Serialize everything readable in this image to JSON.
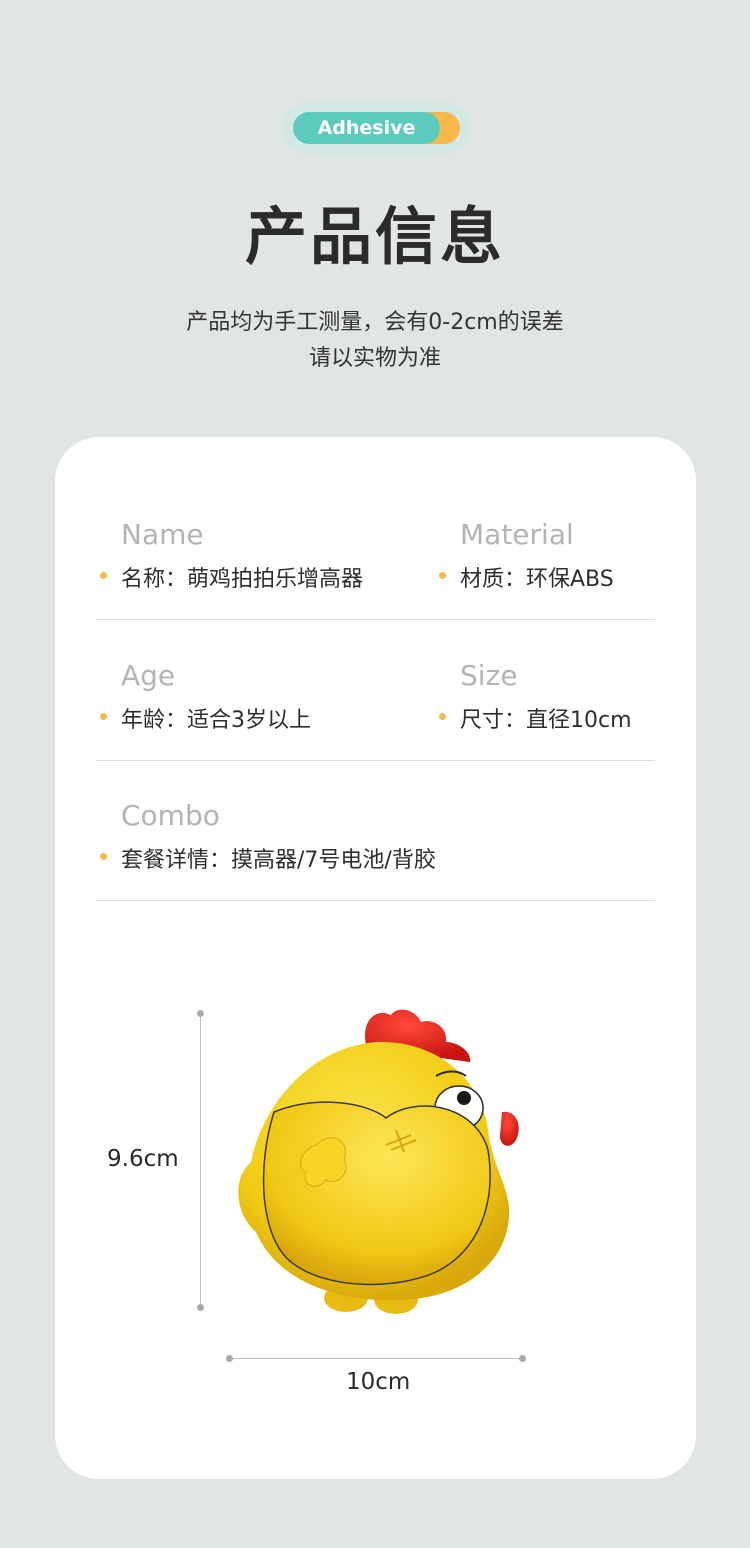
{
  "badge": {
    "label": "Adhesive"
  },
  "title": "产品信息",
  "subtitle": {
    "line1": "产品均为手工测量，会有0-2cm的误差",
    "line2": "请以实物为准"
  },
  "specs": {
    "name": {
      "en": "Name",
      "cn": "名称：萌鸡拍拍乐增高器"
    },
    "material": {
      "en": "Material",
      "cn": "材质：环保ABS"
    },
    "age": {
      "en": "Age",
      "cn": "年龄：适合3岁以上"
    },
    "size": {
      "en": "Size",
      "cn": "尺寸：直径10cm"
    },
    "combo": {
      "en": "Combo",
      "cn": "套餐详情：摸高器/7号电池/背胶"
    }
  },
  "dimensions": {
    "height": "9.6cm",
    "width": "10cm"
  },
  "colors": {
    "accent": "#f7b84a",
    "teal": "#5ccbbf",
    "chick": "#f2d11e",
    "comb": "#e3221c"
  }
}
